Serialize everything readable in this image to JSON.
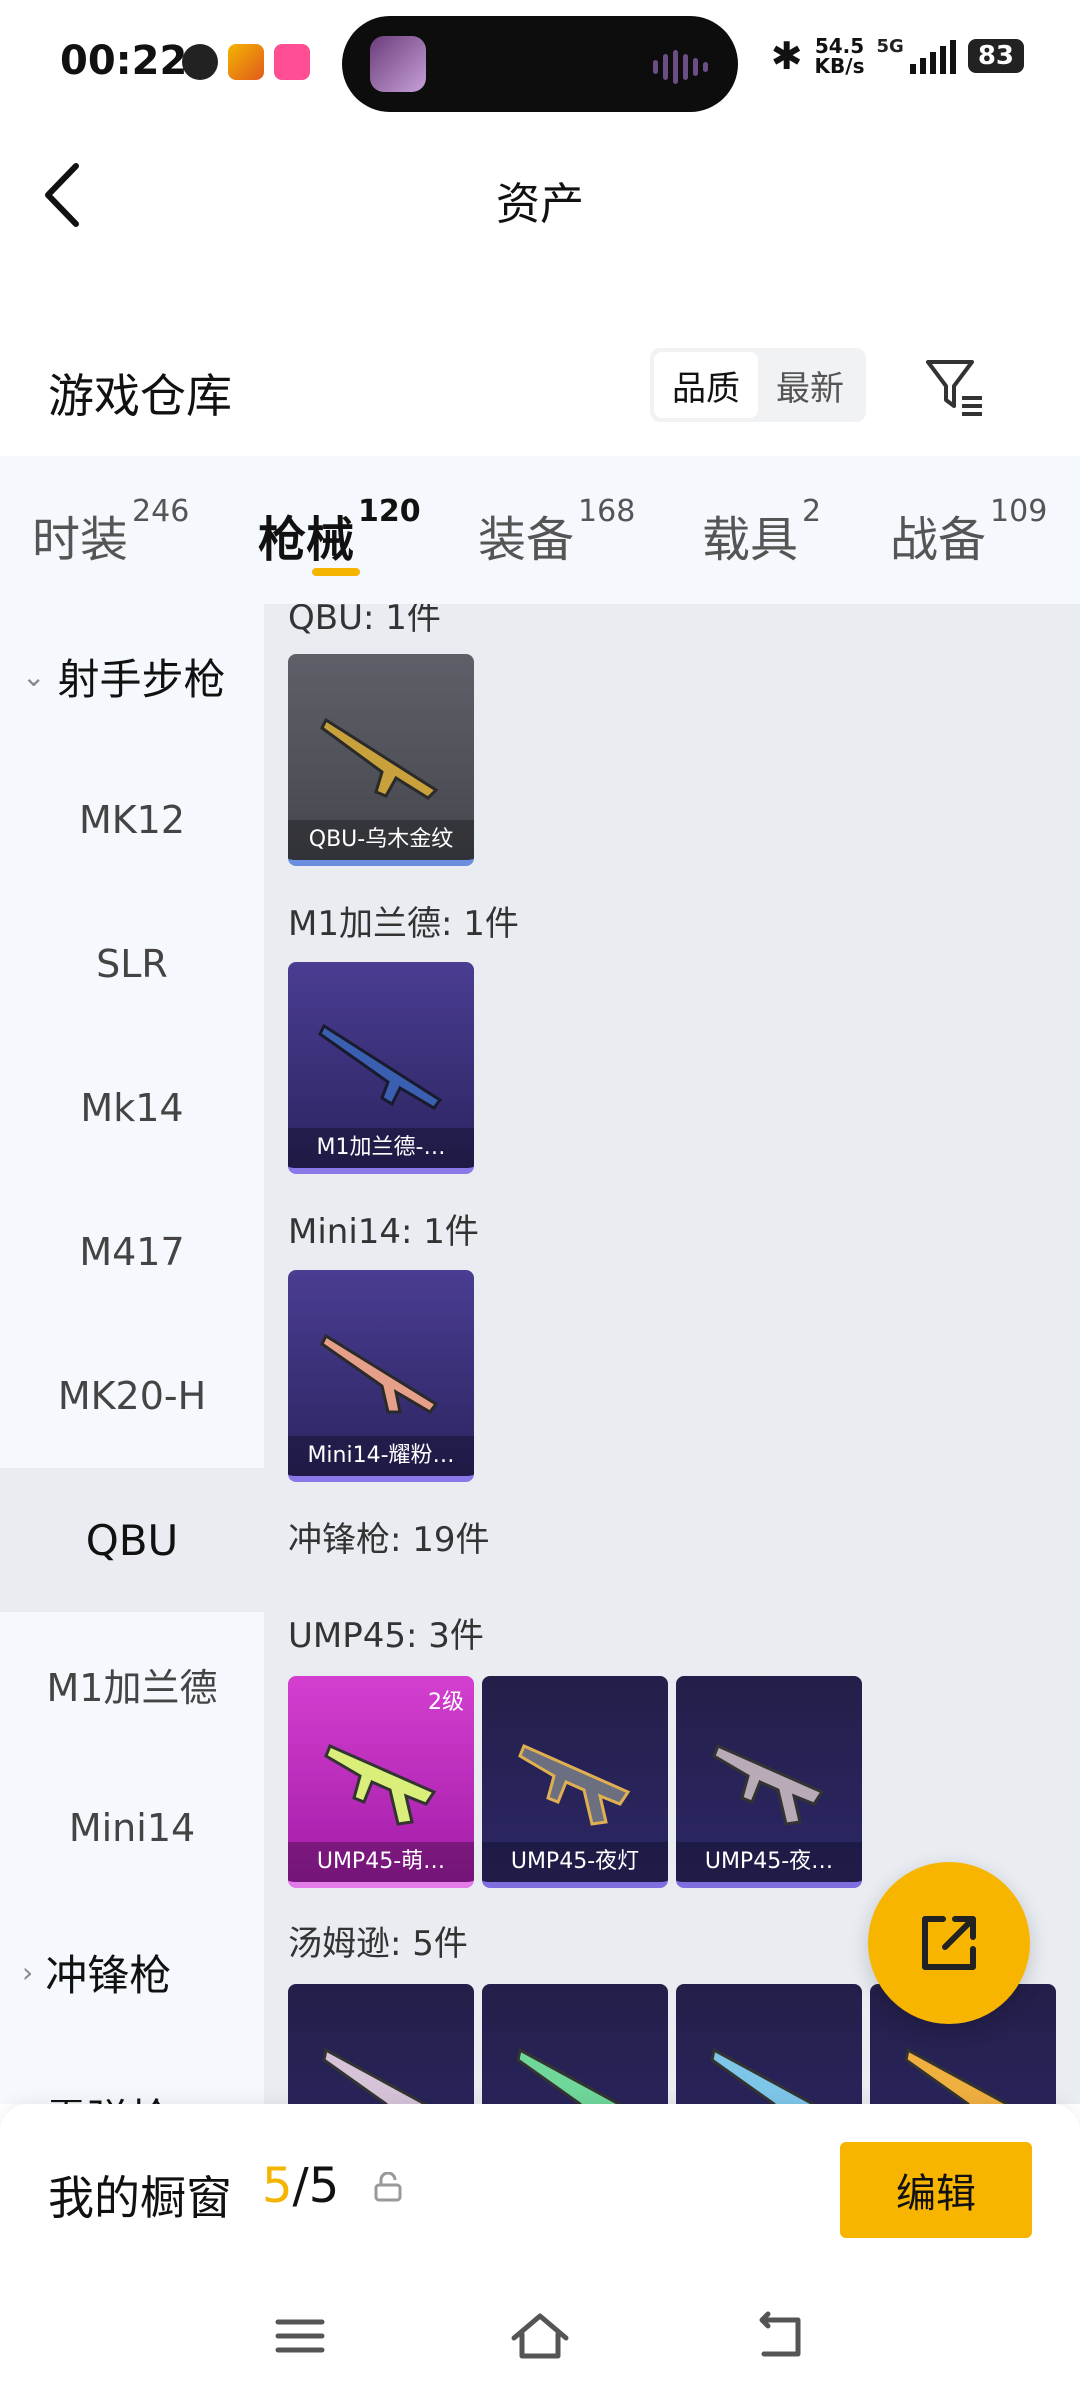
{
  "status_bar": {
    "time": "00:22",
    "net_speed_value": "54.5",
    "net_speed_unit": "KB/s",
    "network": "5G",
    "battery": "83"
  },
  "header": {
    "title": "资产"
  },
  "warehouse": {
    "title": "游戏仓库",
    "sort_options": [
      "品质",
      "最新"
    ],
    "active_sort": "品质"
  },
  "tabs": [
    {
      "label": "时装",
      "count": "246"
    },
    {
      "label": "枪械",
      "count": "120",
      "active": true
    },
    {
      "label": "装备",
      "count": "168"
    },
    {
      "label": "载具",
      "count": "2"
    },
    {
      "label": "战备",
      "count": "109"
    }
  ],
  "sidebar": {
    "group_1": "射手步枪",
    "items": [
      "MK12",
      "SLR",
      "Mk14",
      "M417",
      "MK20-H",
      "QBU",
      "M1加兰德",
      "Mini14"
    ],
    "active_item": "QBU",
    "group_2": "冲锋枪",
    "group_3": "霰弹枪"
  },
  "content": {
    "qbu_label": "QBU: 1件",
    "qbu_card": "QBU-乌木金纹",
    "m1_label": "M1加兰德: 1件",
    "m1_card": "M1加兰德-…",
    "mini14_label": "Mini14: 1件",
    "mini14_card": "Mini14-耀粉…",
    "smg_label": "冲锋枪: 19件",
    "ump_label": "UMP45: 3件",
    "ump_cards": [
      "UMP45-萌…",
      "UMP45-夜灯",
      "UMP45-夜…"
    ],
    "ump_badge": "2级",
    "thompson_label": "汤姆逊: 5件"
  },
  "showcase": {
    "label": "我的橱窗",
    "current": "5",
    "total": "/5",
    "edit_label": "编辑"
  },
  "colors": {
    "accent": "#f5b400",
    "sidebar_bg": "#f5f8fc",
    "content_bg": "#e9edf2"
  },
  "icons": [
    "back-arrow-icon",
    "filter-icon",
    "share-icon",
    "lock-icon",
    "menu-icon",
    "home-icon",
    "return-icon"
  ]
}
